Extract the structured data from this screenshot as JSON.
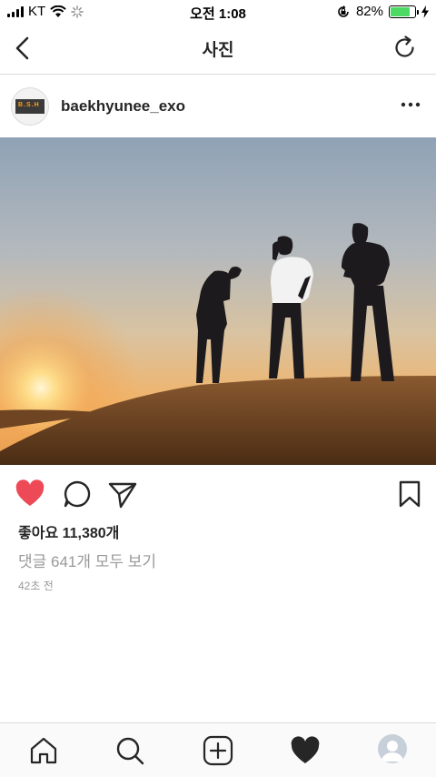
{
  "status_bar": {
    "carrier": "KT",
    "time": "오전 1:08",
    "battery_percent": "82%",
    "battery_level": 0.82,
    "icons": [
      "signal-icon",
      "wifi-icon",
      "activity-spinner-icon",
      "rotation-lock-icon",
      "battery-icon",
      "charging-bolt-icon"
    ]
  },
  "nav": {
    "title": "사진",
    "back_icon": "chevron-left-icon",
    "refresh_icon": "refresh-icon"
  },
  "post": {
    "username": "baekhyunee_exo",
    "avatar_text": "B.S.H",
    "more_icon": "more-horizontal-icon",
    "likes": "좋아요 11,380개",
    "view_comments": "댓글 641개 모두 보기",
    "time_ago": "42초 전"
  },
  "actions": {
    "like_icon": "heart-filled-icon",
    "comment_icon": "comment-icon",
    "share_icon": "send-icon",
    "save_icon": "bookmark-icon"
  },
  "colors": {
    "like_red": "#ed4956",
    "text_dark": "#262626",
    "text_gray": "#999999",
    "battery_green": "#4cd964"
  },
  "tabs": [
    "home-icon",
    "search-icon",
    "add-post-icon",
    "activity-heart-icon",
    "profile-avatar"
  ]
}
